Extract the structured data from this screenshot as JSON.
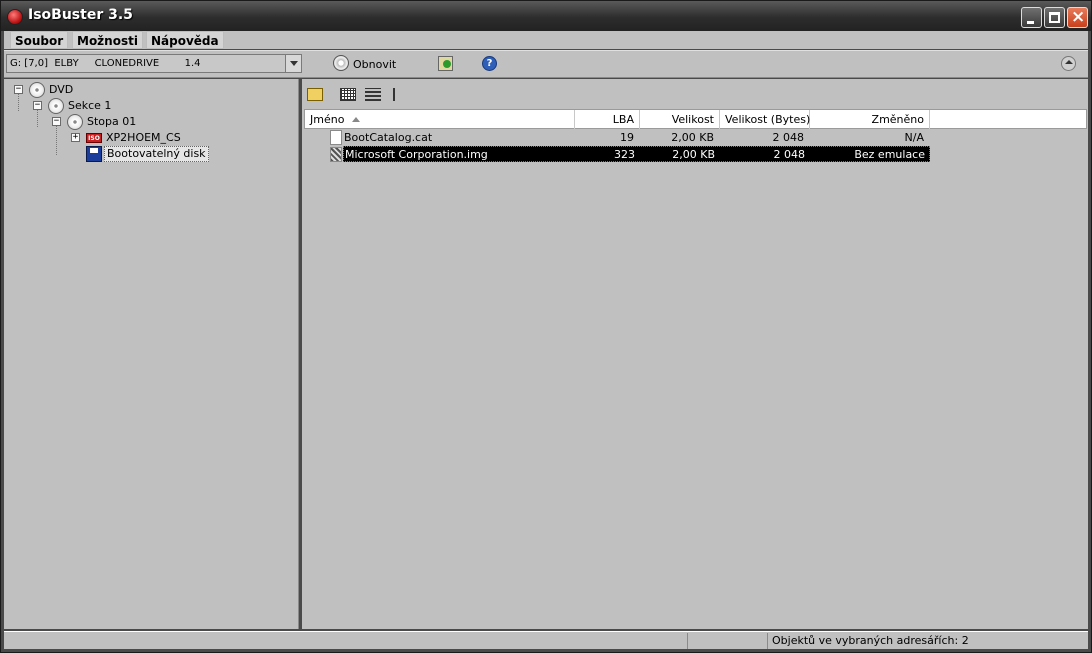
{
  "window": {
    "title": "IsoBuster 3.5"
  },
  "menu": [
    "Soubor",
    "Možnosti",
    "Nápověda"
  ],
  "toolbar": {
    "drive_text": "G: [7,0]  ELBY     CLONEDRIVE        1.4",
    "refresh_label": "Obnovit",
    "help_glyph": "?"
  },
  "tree": {
    "root": "DVD",
    "session": "Sekce 1",
    "track": "Stopa 01",
    "iso_badge": "ISO",
    "iso_label": "XP2HOEM_CS",
    "boot_label": "Bootovatelný disk",
    "expander_minus": "−",
    "expander_plus": "+"
  },
  "list": {
    "columns": [
      "Jméno",
      "LBA",
      "Velikost",
      "Velikost (Bytes)",
      "Změněno"
    ],
    "rows": [
      {
        "name": "BootCatalog.cat",
        "lba": "19",
        "size": "2,00 KB",
        "bytes": "2 048",
        "modified": "N/A",
        "icon": "file-icon"
      },
      {
        "name": "Microsoft Corporation.img",
        "lba": "323",
        "size": "2,00 KB",
        "bytes": "2 048",
        "modified": "Bez emulace",
        "icon": "disk-image-icon"
      }
    ]
  },
  "status": {
    "text": "Objektů ve vybraných adresářích: 2"
  },
  "colors": {
    "background": "#c0c0c0",
    "selection": "#000000",
    "title_text": "#ffffff"
  }
}
